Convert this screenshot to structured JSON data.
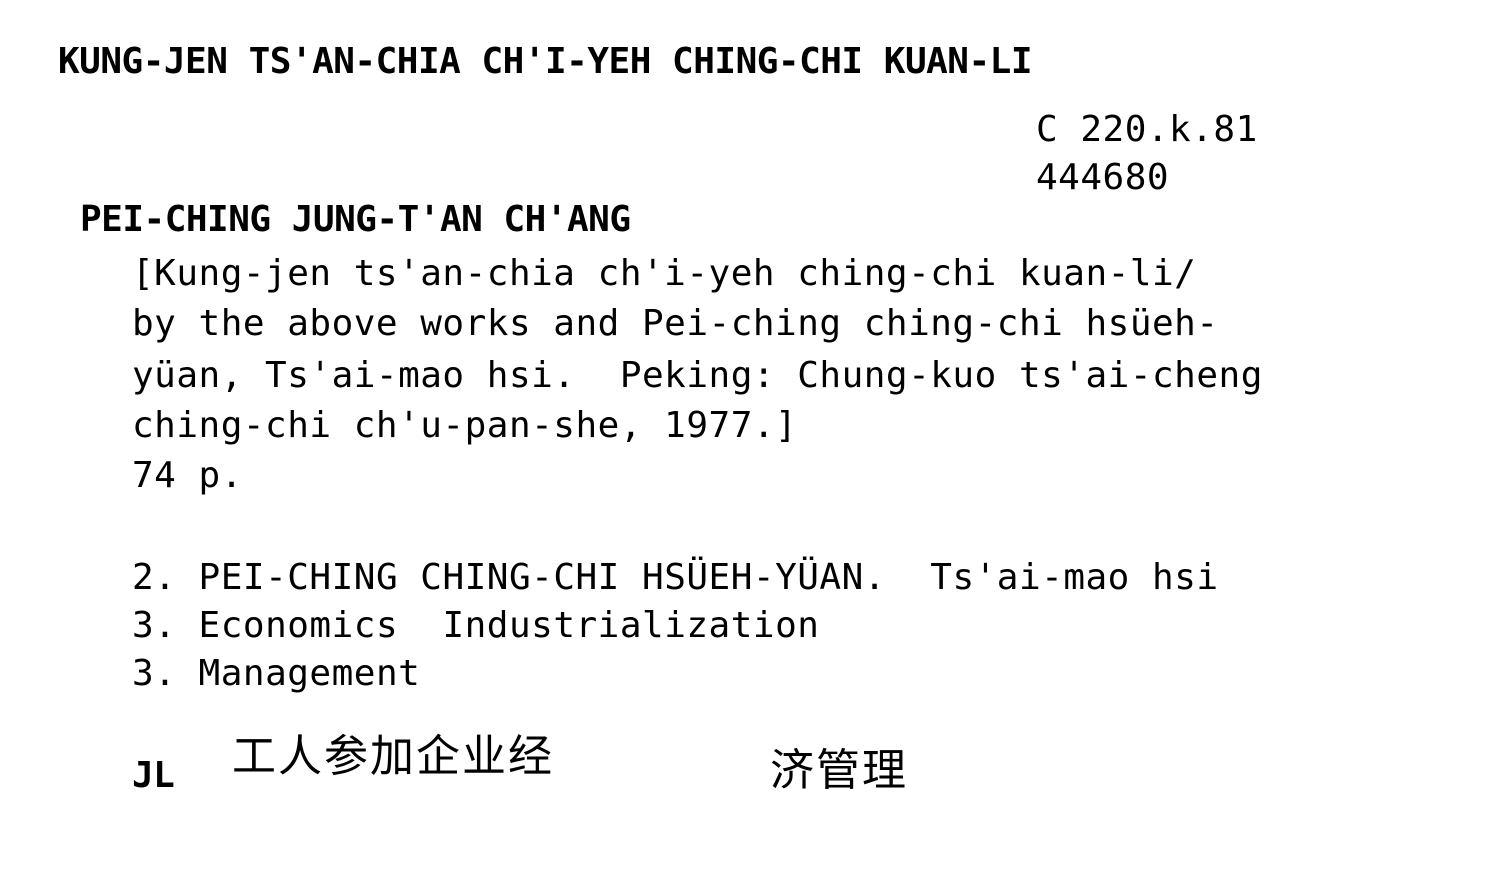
{
  "card": {
    "title_heading": "KUNG-JEN TS'AN-CHIA CH'I-YEH CHING-CHI KUAN-LI",
    "classmark": "C 220.k.81",
    "accession_number": "444680",
    "corporate_author": "PEI-CHING JUNG-T'AN CH'ANG",
    "description_lines": [
      "[Kung-jen ts'an-chia ch'i-yeh ching-chi kuan-li/",
      "by the above works and Pei-ching ching-chi hsüeh-",
      "yüan, Ts'ai-mao hsi.  Peking: Chung-kuo ts'ai-cheng",
      "ching-chi ch'u-pan-she, 1977.]"
    ],
    "collation": "74 p.",
    "tracings": [
      {
        "number": "2.",
        "text": "PEI-CHING CHING-CHI HSÜEH-YÜAN.  Ts'ai-mao hsi"
      },
      {
        "number": "3.",
        "text": "Economics  Industrialization"
      },
      {
        "number": "3.",
        "text": "Management"
      }
    ],
    "language_code": "JL",
    "chinese_title_part1": "工人参加企业经",
    "chinese_title_part2": "济管理"
  },
  "colors": {
    "ink": "#000000",
    "paper": "#ffffff"
  }
}
